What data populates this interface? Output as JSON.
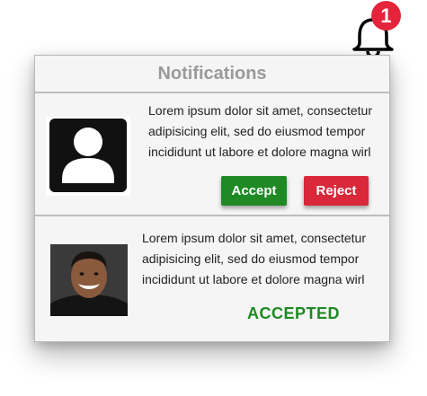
{
  "bell": {
    "icon": "bell-icon",
    "badge_count": "1",
    "badge_color": "#e3243b"
  },
  "panel": {
    "title": "Notifications"
  },
  "notifications": [
    {
      "avatar": "user-placeholder-icon",
      "message": "Lorem ipsum dolor sit amet, consectetur adipisicing elit, sed do eiusmod tempor incididunt ut labore et dolore magna wirl",
      "accept_label": "Accept",
      "reject_label": "Reject"
    },
    {
      "avatar": "user-photo",
      "message": "Lorem ipsum dolor sit amet, consectetur adipisicing elit, sed do eiusmod tempor incididunt ut labore et dolore magna wirl",
      "status": "ACCEPTED"
    }
  ],
  "colors": {
    "accept": "#1f8a25",
    "reject": "#d8283a",
    "header_text": "#9a9a9a"
  }
}
